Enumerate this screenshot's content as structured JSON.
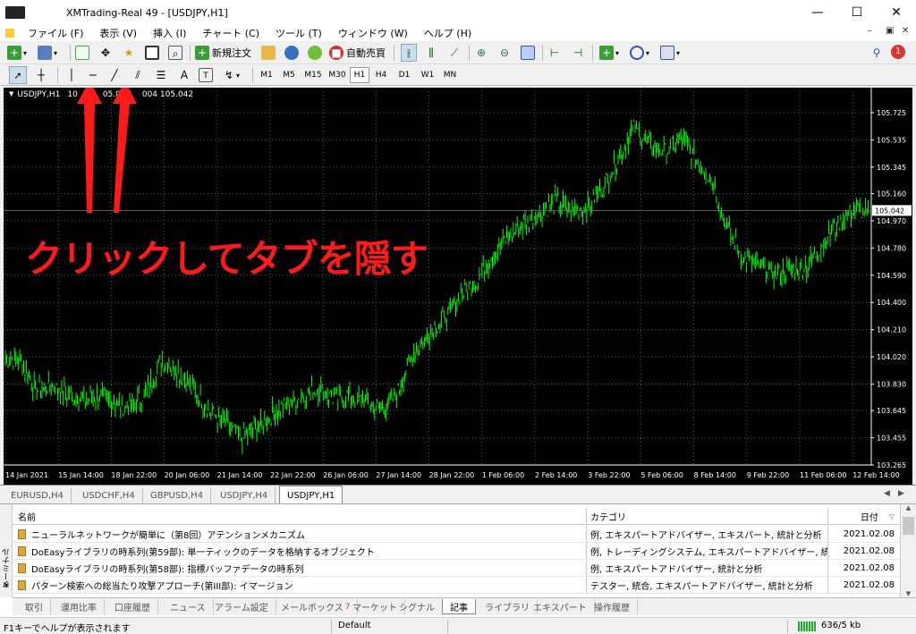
{
  "window": {
    "title": "XMTrading-Real 49 - [USDJPY,H1]"
  },
  "menu": [
    "ファイル (F)",
    "表示 (V)",
    "挿入 (I)",
    "チャート (C)",
    "ツール (T)",
    "ウィンドウ (W)",
    "ヘルプ (H)"
  ],
  "toolbar": {
    "new_order": "新規注文",
    "auto_trade": "自動売買",
    "notify_count": "1"
  },
  "timeframes": [
    "M1",
    "M5",
    "M15",
    "M30",
    "H1",
    "H4",
    "D1",
    "W1",
    "MN"
  ],
  "timeframe_selected": "H1",
  "chart": {
    "symbol_label": "USDJPY,H1",
    "ohlc_fragment_1": "10",
    "ohlc_fragment_2": "05.0",
    "ohlc_fragment_3": "004 105.042",
    "current_price": "105.042",
    "annotation": "クリックしてタブを隠す",
    "colors": {
      "background": "#000000",
      "candle": "#00ff00",
      "grid": "#5a5a5a",
      "annotation": "#ff1a1a"
    }
  },
  "chart_data": {
    "type": "line",
    "y_ticks": [
      "105.725",
      "105.535",
      "105.345",
      "105.160",
      "104.970",
      "104.780",
      "104.590",
      "104.400",
      "104.210",
      "104.020",
      "103.830",
      "103.645",
      "103.455",
      "103.265"
    ],
    "x_ticks": [
      "14 Jan 2021",
      "15 Jan 14:00",
      "18 Jan 22:00",
      "20 Jan 06:00",
      "21 Jan 14:00",
      "22 Jan 22:00",
      "26 Jan 06:00",
      "27 Jan 14:00",
      "28 Jan 22:00",
      "1 Feb 06:00",
      "2 Feb 14:00",
      "3 Feb 22:00",
      "5 Feb 06:00",
      "8 Feb 14:00",
      "9 Feb 22:00",
      "11 Feb 06:00",
      "12 Feb 14:00"
    ],
    "ylim": [
      103.265,
      105.725
    ],
    "series": [
      {
        "values": [
          104.02,
          103.98,
          103.78,
          103.82,
          103.76,
          103.72,
          103.75,
          103.7,
          103.66,
          103.78,
          104.0,
          103.92,
          103.78,
          103.64,
          103.55,
          103.45,
          103.52,
          103.62,
          103.7,
          103.75,
          103.8,
          103.72,
          103.75,
          103.7,
          103.65,
          103.78,
          104.05,
          104.18,
          104.3,
          104.45,
          104.55,
          104.72,
          104.86,
          104.95,
          105.02,
          105.1,
          105.05,
          105.06,
          105.2,
          105.4,
          105.62,
          105.5,
          105.45,
          105.55,
          105.4,
          105.25,
          104.9,
          104.7,
          104.65,
          104.6,
          104.62,
          104.65,
          104.8,
          104.95,
          105.05,
          105.02
        ]
      }
    ]
  },
  "chart_tabs": [
    "EURUSD,H4",
    "USDCHF,H4",
    "GBPUSD,H4",
    "USDJPY,H4",
    "USDJPY,H1"
  ],
  "chart_tab_selected": "USDJPY,H1",
  "terminal": {
    "side_label": "ターミナル",
    "columns": {
      "name": "名前",
      "category": "カテゴリ",
      "date": "日付"
    },
    "rows": [
      {
        "name": "ニューラルネットワークが簡単に（第8回）アテンションメカニズム",
        "category": "例, エキスパートアドバイザー, エキスパート, 統計と分析",
        "date": "2021.02.08"
      },
      {
        "name": "DoEasyライブラリの時系列(第59部): 単一ティックのデータを格納するオブジェクト",
        "category": "例, トレーディングシステム, エキスパートアドバイザー, 統計と分析",
        "date": "2021.02.08"
      },
      {
        "name": "DoEasyライブラリの時系列(第58部): 指標バッファデータの時系列",
        "category": "例, エキスパートアドバイザー, 統計と分析",
        "date": "2021.02.08"
      },
      {
        "name": "パターン検索への総当たり攻撃アプローチ(第III部): イマージョン",
        "category": "テスター, 統合, エキスパートアドバイザー, 統計と分析",
        "date": "2021.02.08"
      }
    ],
    "tabs": [
      "取引",
      "運用比率",
      "口座履歴",
      "ニュース",
      "アラーム設定",
      "メールボックス",
      "マーケット",
      "シグナル",
      "記事",
      "ライブラリ",
      "エキスパート",
      "操作履歴"
    ],
    "mailbox_badge": "7",
    "tab_selected": "記事"
  },
  "status": {
    "help": "F1キーでヘルプが表示されます",
    "profile": "Default",
    "traffic": "636/5 kb"
  }
}
